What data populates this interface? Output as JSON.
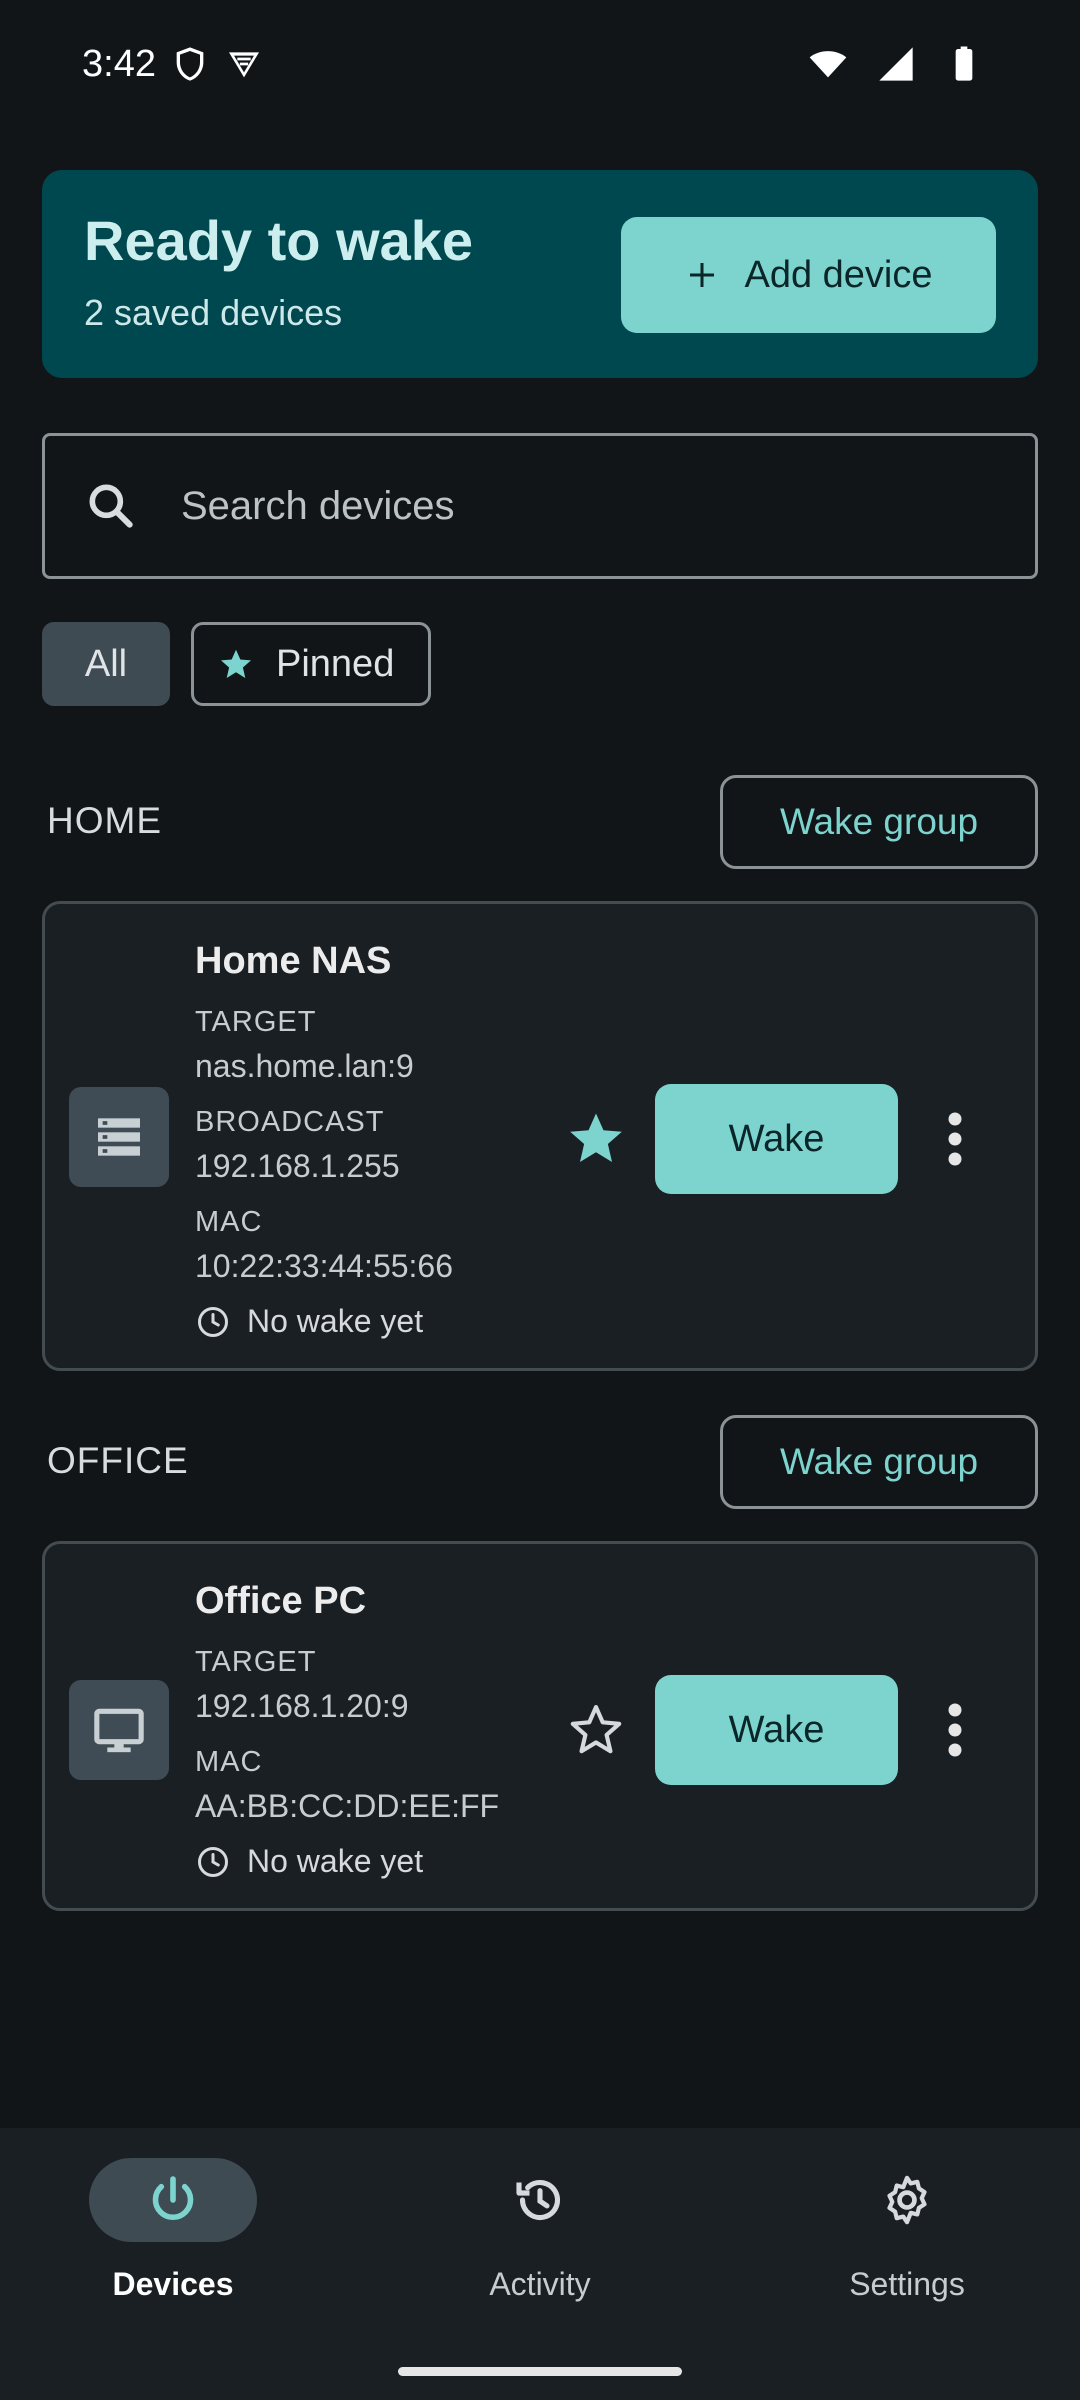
{
  "status_bar": {
    "time": "3:42"
  },
  "hero": {
    "title": "Ready to wake",
    "subtitle": "2 saved devices",
    "add_label": "Add device"
  },
  "search": {
    "placeholder": "Search devices"
  },
  "filters": {
    "all": "All",
    "pinned": "Pinned"
  },
  "groups": [
    {
      "label": "HOME",
      "wake_group": "Wake group",
      "device": {
        "name": "Home NAS",
        "icon": "server-icon",
        "target_label": "TARGET",
        "target": "nas.home.lan:9",
        "broadcast_label": "BROADCAST",
        "broadcast": "192.168.1.255",
        "mac_label": "MAC",
        "mac": "10:22:33:44:55:66",
        "last_wake": "No wake yet",
        "pinned": true,
        "wake_label": "Wake"
      }
    },
    {
      "label": "OFFICE",
      "wake_group": "Wake group",
      "device": {
        "name": "Office PC",
        "icon": "monitor-icon",
        "target_label": "TARGET",
        "target": "192.168.1.20:9",
        "mac_label": "MAC",
        "mac": "AA:BB:CC:DD:EE:FF",
        "last_wake": "No wake yet",
        "pinned": false,
        "wake_label": "Wake"
      }
    }
  ],
  "nav": {
    "devices": "Devices",
    "activity": "Activity",
    "settings": "Settings"
  },
  "colors": {
    "background": "#111518",
    "accent": "#7dd3ce",
    "hero": "#00484f",
    "card": "#1a1f23"
  }
}
